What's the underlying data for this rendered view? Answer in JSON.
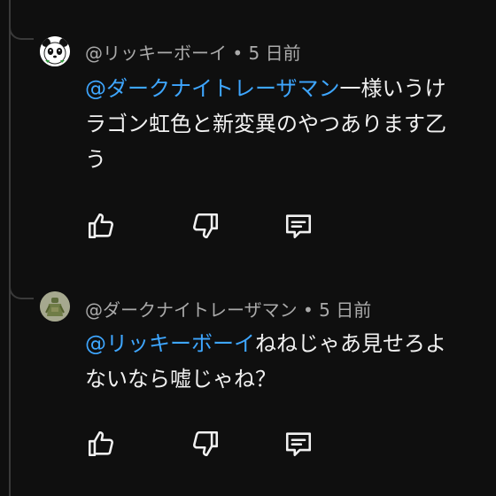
{
  "comments": [
    {
      "author": "@リッキーボーイ",
      "separator": "•",
      "time": "5 日前",
      "mention": "@ダークナイトレーザマン",
      "text_line1": "一様いうけ",
      "text_line2": "ラゴン虹色と新変異のやつあります乙",
      "text_line3": "う",
      "avatar_icon": "panda-avatar-icon"
    },
    {
      "author": "@ダークナイトレーザマン",
      "separator": "•",
      "time": "5 日前",
      "mention": "@リッキーボーイ",
      "text_line1": "ねねじゃあ見せろよ",
      "text_line2": "ないなら嘘じゃね？",
      "avatar_icon": "figure-avatar-icon"
    }
  ],
  "icons": {
    "like": "thumbs-up-icon",
    "dislike": "thumbs-down-icon",
    "reply": "reply-comment-icon"
  },
  "colors": {
    "background": "#0f0f0f",
    "mention": "#3ea6ff",
    "meta": "#aaaaaa",
    "text": "#f1f1f1"
  }
}
